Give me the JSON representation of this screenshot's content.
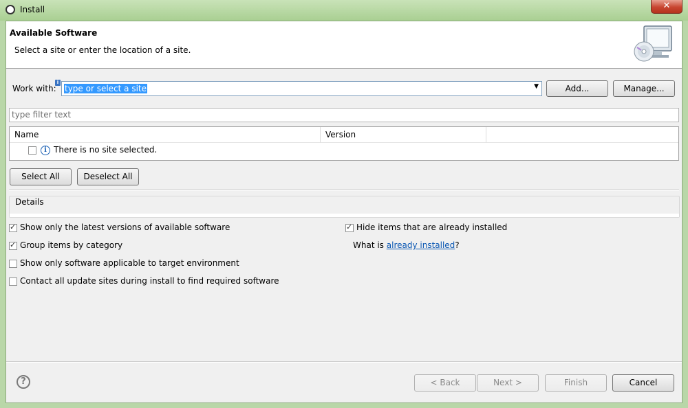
{
  "window": {
    "title": "Install",
    "close_glyph": "✕"
  },
  "banner": {
    "title": "Available Software",
    "message": "Select a site or enter the location of a site.",
    "graphic_icon": "monitor-cd-icon"
  },
  "work_with": {
    "label": "Work with:",
    "value": "type or select a site",
    "add_label": "Add...",
    "manage_label": "Manage..."
  },
  "filter": {
    "placeholder": "type filter text"
  },
  "table": {
    "columns": [
      "Name",
      "Version"
    ],
    "rows": [
      {
        "checked": false,
        "icon": "info-icon",
        "name": "There is no site selected.",
        "version": ""
      }
    ]
  },
  "selection": {
    "select_all_label": "Select All",
    "deselect_all_label": "Deselect All"
  },
  "details": {
    "label": "Details"
  },
  "options": {
    "show_latest": {
      "label": "Show only the latest versions of available software",
      "checked": true
    },
    "group_by_category": {
      "label": "Group items by category",
      "checked": true
    },
    "show_applicable": {
      "label": "Show only software applicable to target environment",
      "checked": false
    },
    "contact_all_sites": {
      "label": "Contact all update sites during install to find required software",
      "checked": false
    },
    "hide_installed": {
      "label": "Hide items that are already installed",
      "checked": true
    },
    "what_is_prefix": "What is ",
    "already_installed_link": "already installed",
    "what_is_suffix": "?"
  },
  "footer": {
    "help_glyph": "?",
    "back_label": "< Back",
    "next_label": "Next >",
    "finish_label": "Finish",
    "cancel_label": "Cancel"
  }
}
